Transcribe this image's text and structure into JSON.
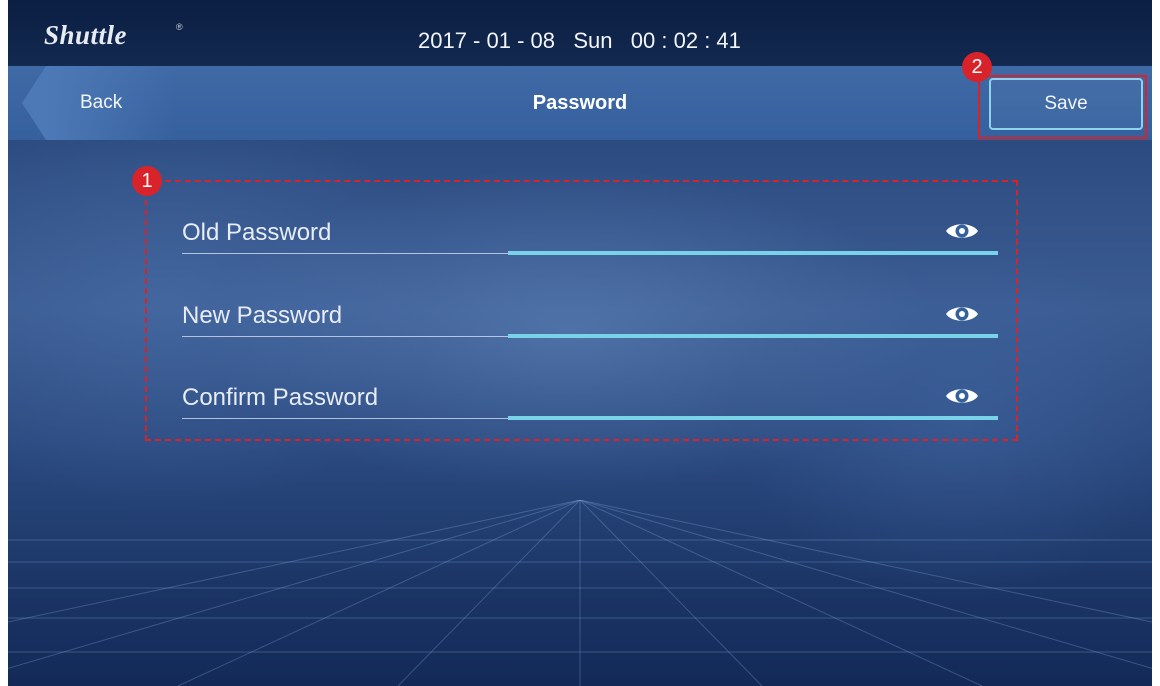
{
  "statusbar": {
    "brand": "Shuttle",
    "brand_mark": "®",
    "datetime": "2017 - 01 - 08   Sun   00 : 02 : 41"
  },
  "navbar": {
    "back_label": "Back",
    "title": "Password",
    "save_label": "Save"
  },
  "form": {
    "fields": [
      {
        "label": "Old Password",
        "value": "",
        "icon": "eye-icon"
      },
      {
        "label": "New Password",
        "value": "",
        "icon": "eye-icon"
      },
      {
        "label": "Confirm Password",
        "value": "",
        "icon": "eye-icon"
      }
    ]
  },
  "callouts": {
    "form_badge": "1",
    "save_badge": "2"
  },
  "colors": {
    "accent": "#78d2e8",
    "callout": "#d8232a",
    "navbar": "#3f6aa6",
    "statusbar": "#0b1e43"
  }
}
